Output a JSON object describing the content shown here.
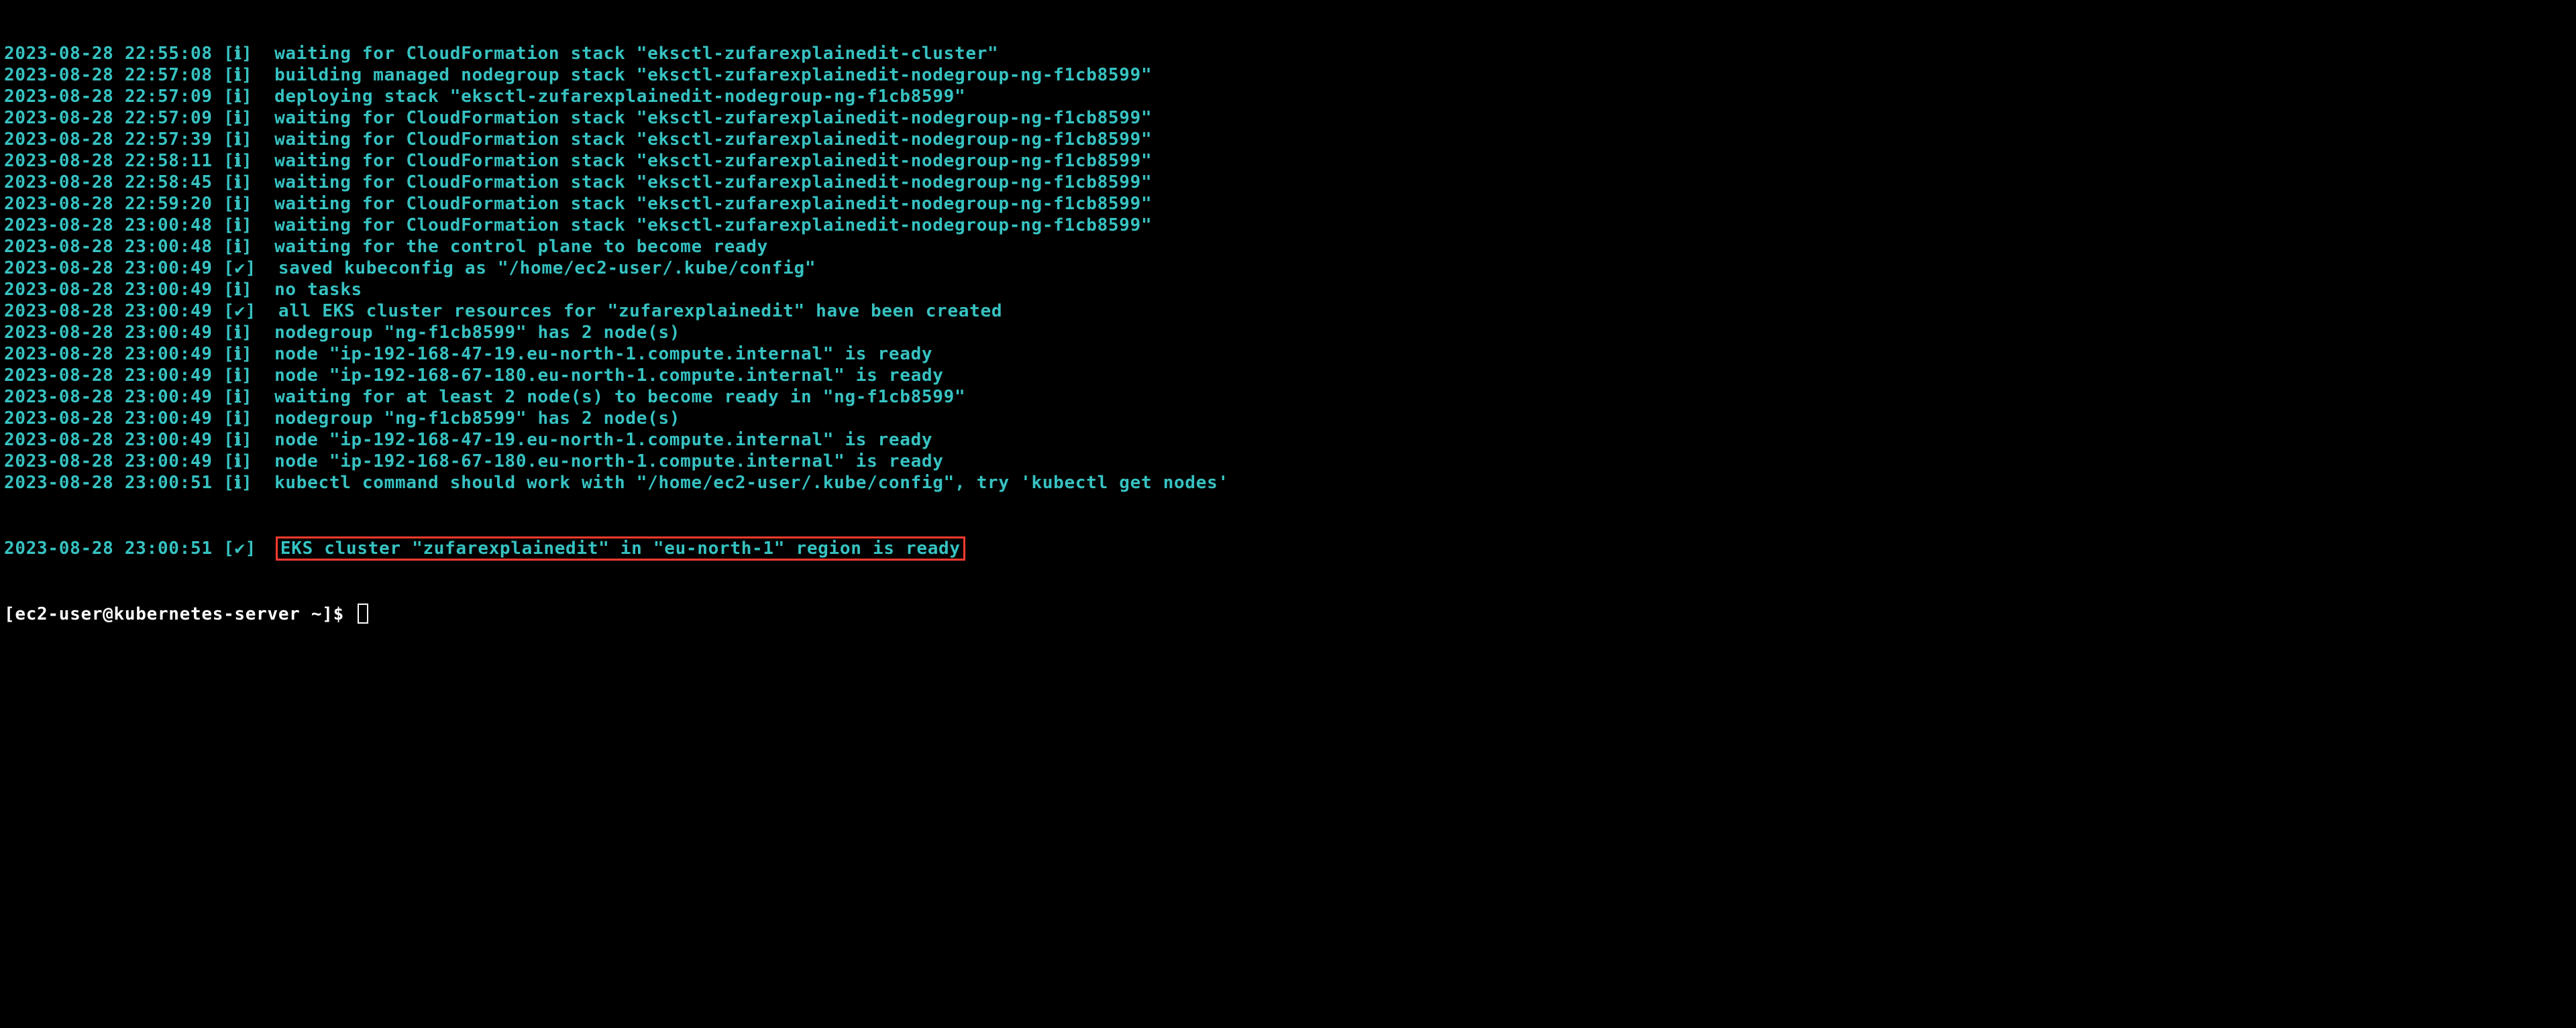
{
  "log_lines": [
    {
      "ts": "2023-08-28 22:55:08",
      "level": "ℹ",
      "msg": "  waiting for CloudFormation stack \"eksctl-zufarexplainedit-cluster\""
    },
    {
      "ts": "2023-08-28 22:57:08",
      "level": "ℹ",
      "msg": "  building managed nodegroup stack \"eksctl-zufarexplainedit-nodegroup-ng-f1cb8599\""
    },
    {
      "ts": "2023-08-28 22:57:09",
      "level": "ℹ",
      "msg": "  deploying stack \"eksctl-zufarexplainedit-nodegroup-ng-f1cb8599\""
    },
    {
      "ts": "2023-08-28 22:57:09",
      "level": "ℹ",
      "msg": "  waiting for CloudFormation stack \"eksctl-zufarexplainedit-nodegroup-ng-f1cb8599\""
    },
    {
      "ts": "2023-08-28 22:57:39",
      "level": "ℹ",
      "msg": "  waiting for CloudFormation stack \"eksctl-zufarexplainedit-nodegroup-ng-f1cb8599\""
    },
    {
      "ts": "2023-08-28 22:58:11",
      "level": "ℹ",
      "msg": "  waiting for CloudFormation stack \"eksctl-zufarexplainedit-nodegroup-ng-f1cb8599\""
    },
    {
      "ts": "2023-08-28 22:58:45",
      "level": "ℹ",
      "msg": "  waiting for CloudFormation stack \"eksctl-zufarexplainedit-nodegroup-ng-f1cb8599\""
    },
    {
      "ts": "2023-08-28 22:59:20",
      "level": "ℹ",
      "msg": "  waiting for CloudFormation stack \"eksctl-zufarexplainedit-nodegroup-ng-f1cb8599\""
    },
    {
      "ts": "2023-08-28 23:00:48",
      "level": "ℹ",
      "msg": "  waiting for CloudFormation stack \"eksctl-zufarexplainedit-nodegroup-ng-f1cb8599\""
    },
    {
      "ts": "2023-08-28 23:00:48",
      "level": "ℹ",
      "msg": "  waiting for the control plane to become ready"
    },
    {
      "ts": "2023-08-28 23:00:49",
      "level": "✔",
      "msg": "  saved kubeconfig as \"/home/ec2-user/.kube/config\""
    },
    {
      "ts": "2023-08-28 23:00:49",
      "level": "ℹ",
      "msg": "  no tasks"
    },
    {
      "ts": "2023-08-28 23:00:49",
      "level": "✔",
      "msg": "  all EKS cluster resources for \"zufarexplainedit\" have been created"
    },
    {
      "ts": "2023-08-28 23:00:49",
      "level": "ℹ",
      "msg": "  nodegroup \"ng-f1cb8599\" has 2 node(s)"
    },
    {
      "ts": "2023-08-28 23:00:49",
      "level": "ℹ",
      "msg": "  node \"ip-192-168-47-19.eu-north-1.compute.internal\" is ready"
    },
    {
      "ts": "2023-08-28 23:00:49",
      "level": "ℹ",
      "msg": "  node \"ip-192-168-67-180.eu-north-1.compute.internal\" is ready"
    },
    {
      "ts": "2023-08-28 23:00:49",
      "level": "ℹ",
      "msg": "  waiting for at least 2 node(s) to become ready in \"ng-f1cb8599\""
    },
    {
      "ts": "2023-08-28 23:00:49",
      "level": "ℹ",
      "msg": "  nodegroup \"ng-f1cb8599\" has 2 node(s)"
    },
    {
      "ts": "2023-08-28 23:00:49",
      "level": "ℹ",
      "msg": "  node \"ip-192-168-47-19.eu-north-1.compute.internal\" is ready"
    },
    {
      "ts": "2023-08-28 23:00:49",
      "level": "ℹ",
      "msg": "  node \"ip-192-168-67-180.eu-north-1.compute.internal\" is ready"
    },
    {
      "ts": "2023-08-28 23:00:51",
      "level": "ℹ",
      "msg": "  kubectl command should work with \"/home/ec2-user/.kube/config\", try 'kubectl get nodes'"
    }
  ],
  "highlighted_line": {
    "ts": "2023-08-28 23:00:51",
    "level": "✔",
    "msg": "EKS cluster \"zufarexplainedit\" in \"eu-north-1\" region is ready"
  },
  "prompt": "[ec2-user@kubernetes-server ~]$ "
}
